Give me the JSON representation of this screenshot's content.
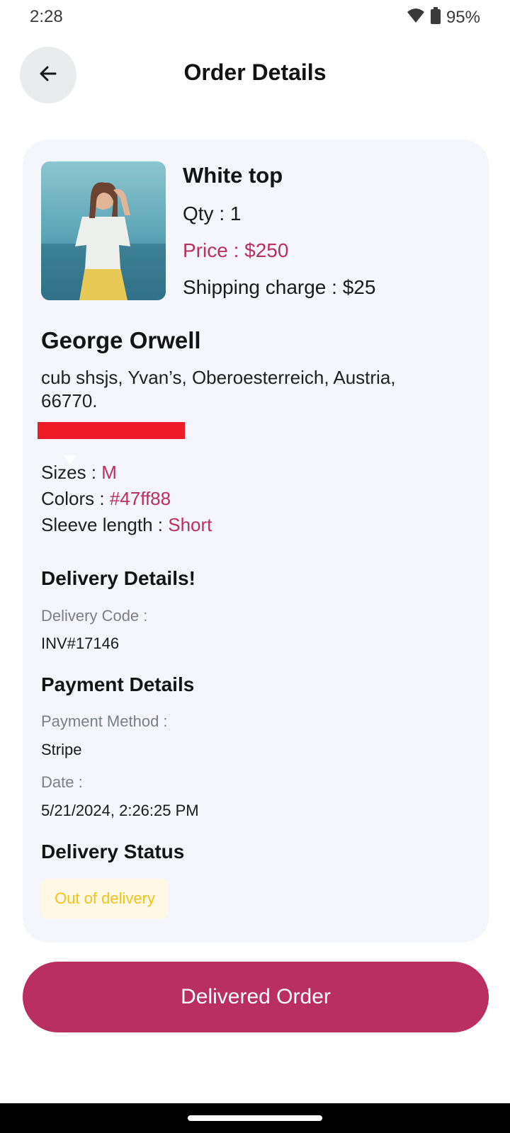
{
  "status_bar": {
    "time": "2:28",
    "battery": "95%"
  },
  "header": {
    "title": "Order Details"
  },
  "product": {
    "name": "White top",
    "qty": "Qty : 1",
    "price": "Price : $250",
    "shipping": "Shipping charge : $25"
  },
  "customer": {
    "name": "George Orwell",
    "address": "cub shsjs, Yvan’s, Oberoesterreich, Austria, 66770."
  },
  "attributes": {
    "size_label": "Sizes : ",
    "size_value": "M",
    "color_label": "Colors : ",
    "color_value": "#47ff88",
    "sleeve_label": "Sleeve length : ",
    "sleeve_value": "Short"
  },
  "delivery": {
    "title": "Delivery Details!",
    "code_label": "Delivery Code :",
    "code_value": "INV#17146"
  },
  "payment": {
    "title": "Payment Details",
    "method_label": "Payment Method :",
    "method_value": "Stripe",
    "date_label": "Date :",
    "date_value": "5/21/2024, 2:26:25 PM"
  },
  "status": {
    "title": "Delivery Status",
    "chip": "Out of delivery"
  },
  "actions": {
    "primary": "Delivered Order"
  },
  "colors": {
    "accent": "#b93060",
    "card_bg": "#f5f6fb",
    "chip_bg": "#fff8e5",
    "chip_text": "#f2c21b",
    "redaction": "#ee1c26"
  },
  "icons": {
    "back": "arrow-left-icon",
    "wifi": "wifi-icon",
    "battery": "battery-icon"
  }
}
